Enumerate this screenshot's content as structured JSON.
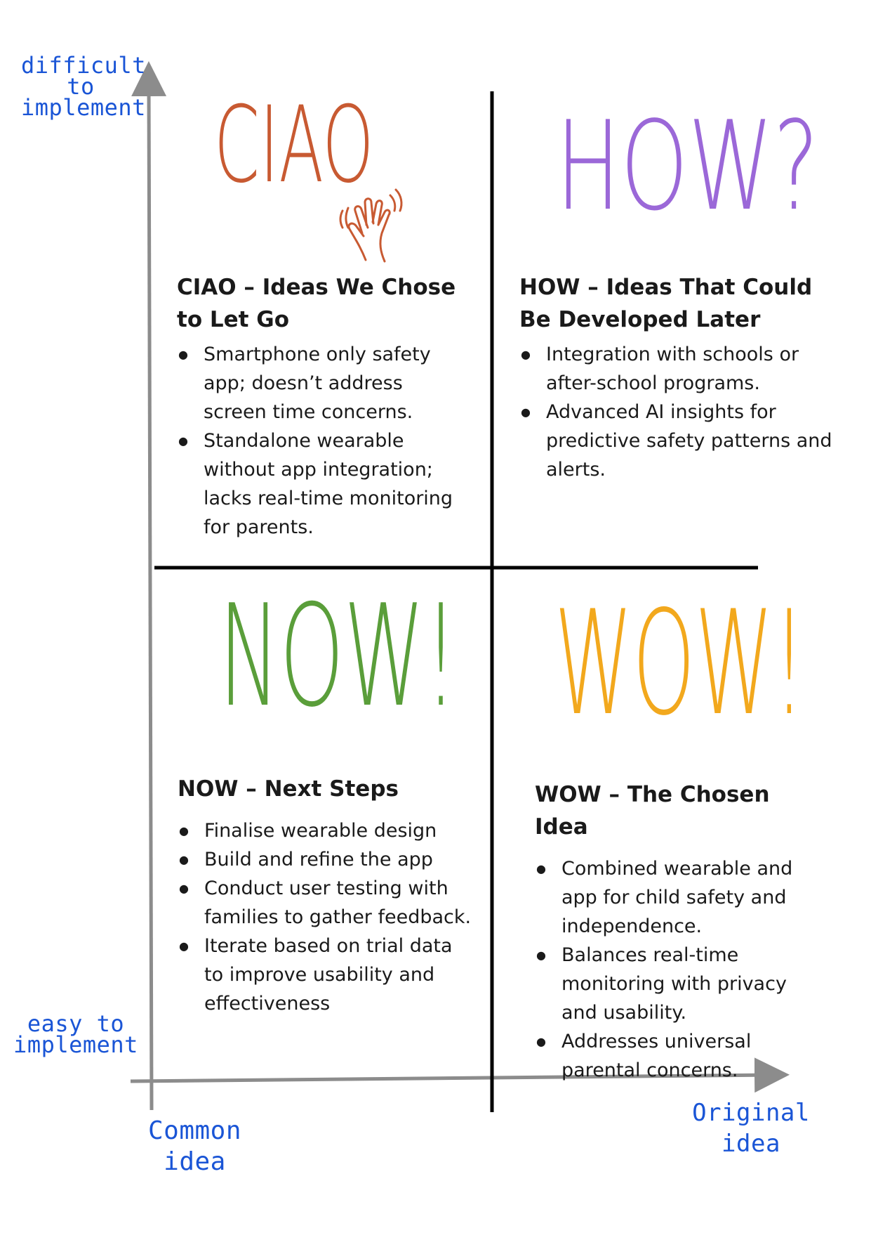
{
  "axes": {
    "y_top_label": [
      "difficult",
      "to",
      "implement"
    ],
    "y_bottom_label": [
      "easy to",
      "implement"
    ],
    "x_left_label": [
      "Common",
      "idea"
    ],
    "x_right_label": [
      "Original",
      "idea"
    ],
    "axis_color": "#8c8c8c",
    "divider_color": "#000000",
    "handwriting_color": "#1a55d6"
  },
  "quadrants": {
    "ciao": {
      "word": "CIAO",
      "color": "#c85a32",
      "heading": "CIAO – Ideas We Chose to Let Go",
      "items": [
        "Smartphone only safety app; doesn’t address screen time concerns.",
        "Standalone wearable without app integration; lacks real-time monitoring for parents."
      ]
    },
    "how": {
      "word": "HOW?",
      "color": "#9b68d8",
      "heading": "HOW – Ideas That Could Be Developed Later",
      "items": [
        "Integration with schools or after-school programs.",
        "Advanced AI insights for predictive safety patterns and alerts."
      ]
    },
    "now": {
      "word": "NOW!",
      "color": "#5a9e3a",
      "heading": "NOW – Next Steps",
      "items": [
        "Finalise wearable design",
        "Build and refine the app",
        "Conduct user testing with families to gather feedback.",
        "Iterate based on trial data to improve usability and effectiveness"
      ]
    },
    "wow": {
      "word": "WOW!",
      "color": "#f2a81d",
      "heading": "WOW – The Chosen Idea",
      "items": [
        "Combined wearable and app for child safety and independence.",
        "Balances real-time monitoring with privacy and usability.",
        "Addresses universal parental concerns."
      ]
    }
  }
}
